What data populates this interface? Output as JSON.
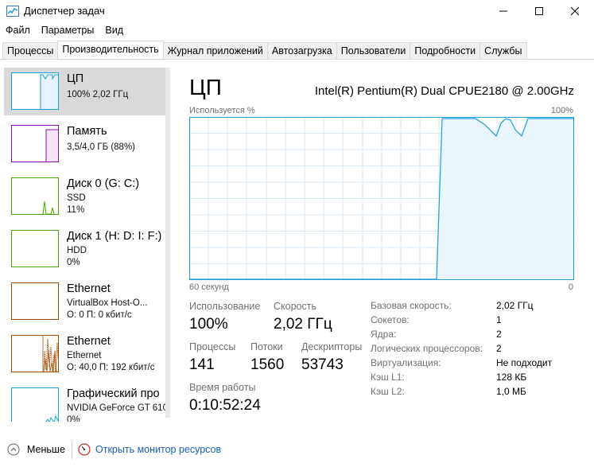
{
  "window": {
    "title": "Диспетчер задач"
  },
  "menu": [
    "Файл",
    "Параметры",
    "Вид"
  ],
  "tabs": [
    "Процессы",
    "Производительность",
    "Журнал приложений",
    "Автозагрузка",
    "Пользователи",
    "Подробности",
    "Службы"
  ],
  "active_tab": "Производительность",
  "sidebar": {
    "items": [
      {
        "title": "ЦП",
        "sub1": "100%  2,02 ГГц",
        "sub2": "",
        "color": "#1a9fd8"
      },
      {
        "title": "Память",
        "sub1": "3,5/4,0 ГБ (88%)",
        "sub2": "",
        "color": "#8b12ae"
      },
      {
        "title": "Диск 0 (G: C:)",
        "sub1": "SSD",
        "sub2": "11%",
        "color": "#4da60c"
      },
      {
        "title": "Диск 1 (H: D: I: F:)",
        "sub1": "HDD",
        "sub2": "0%",
        "color": "#4da60c"
      },
      {
        "title": "Ethernet",
        "sub1": "VirtualBox Host-O...",
        "sub2": "О: 0 П: 0 кбит/с",
        "color": "#a74f01"
      },
      {
        "title": "Ethernet",
        "sub1": "Ethernet",
        "sub2": "О: 40,0  П: 192 кбит/с",
        "color": "#a74f01"
      },
      {
        "title": "Графический про",
        "sub1": "NVIDIA GeForce GT 610",
        "sub2": "0%",
        "color": "#1a9fd8"
      }
    ]
  },
  "main": {
    "title": "ЦП",
    "cpu_model": "Intel(R) Pentium(R) Dual CPUE2180 @ 2.00GHz",
    "graph": {
      "top_label": "Используется %",
      "top_right": "100%",
      "bottom_left": "60 секунд",
      "bottom_right": "0",
      "color": "#1a9fd8"
    },
    "stats": {
      "usage_label": "Использование",
      "usage_value": "100%",
      "speed_label": "Скорость",
      "speed_value": "2,02 ГГц",
      "processes_label": "Процессы",
      "processes_value": "141",
      "threads_label": "Потоки",
      "threads_value": "1560",
      "handles_label": "Дескрипторы",
      "handles_value": "53743",
      "uptime_label": "Время работы",
      "uptime_value": "0:10:52:24"
    },
    "info": [
      {
        "label": "Базовая скорость:",
        "value": "2,02 ГГц"
      },
      {
        "label": "Сокетов:",
        "value": "1"
      },
      {
        "label": "Ядра:",
        "value": "2"
      },
      {
        "label": "Логических процессоров:",
        "value": "2"
      },
      {
        "label": "Виртуализация:",
        "value": "Не подходит"
      },
      {
        "label": "Кэш L1:",
        "value": "128 КБ"
      },
      {
        "label": "Кэш L2:",
        "value": "1,0 МБ"
      }
    ]
  },
  "footer": {
    "fewer_label": "Меньше",
    "resmon_label": "Открыть монитор ресурсов"
  }
}
